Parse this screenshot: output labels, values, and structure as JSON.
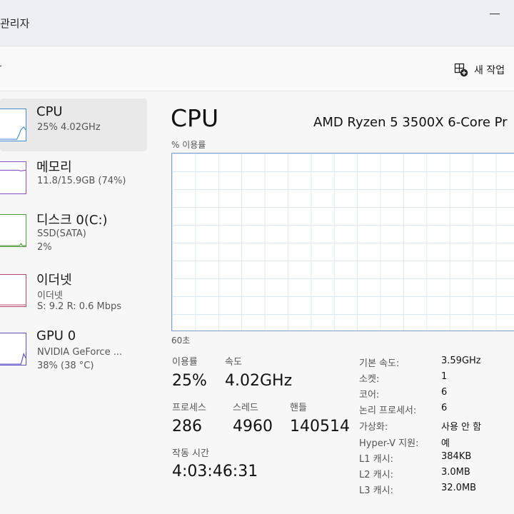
{
  "window": {
    "title": "관리자"
  },
  "toolbar": {
    "new_task_label": "새 작업",
    "new_task_icon": "new-task-icon"
  },
  "sidebar": {
    "items": [
      {
        "name": "CPU",
        "line1": "25% 4.02GHz",
        "line2": ""
      },
      {
        "name": "메모리",
        "line1": "11.8/15.9GB (74%)",
        "line2": ""
      },
      {
        "name": "디스크 0(C:)",
        "line1": "SSD(SATA)",
        "line2": "2%"
      },
      {
        "name": "이더넷",
        "line1": "이더넷",
        "line2": "S: 9.2 R: 0.6 Mbps"
      },
      {
        "name": "GPU 0",
        "line1": "NVIDIA GeForce ...",
        "line2": "38% (38 °C)"
      }
    ]
  },
  "main": {
    "title": "CPU",
    "model": "AMD Ryzen 5 3500X 6-Core Pr",
    "usage_label": "% 이용률",
    "time_label": "60초",
    "stats": {
      "utilization_label": "이용률",
      "utilization": "25%",
      "speed_label": "속도",
      "speed": "4.02GHz",
      "processes_label": "프로세스",
      "processes": "286",
      "threads_label": "스레드",
      "threads": "4960",
      "handles_label": "핸들",
      "handles": "140514",
      "uptime_label": "작동 시간",
      "uptime": "4:03:46:31"
    },
    "specs": [
      {
        "key": "기본 속도:",
        "value": "3.59GHz"
      },
      {
        "key": "소켓:",
        "value": "1"
      },
      {
        "key": "코어:",
        "value": "6"
      },
      {
        "key": "논리 프로세서:",
        "value": "6"
      },
      {
        "key": "가상화:",
        "value": "사용 안 함"
      },
      {
        "key": "Hyper-V 지원:",
        "value": "예"
      },
      {
        "key": "L1 캐시:",
        "value": "384KB"
      },
      {
        "key": "L2 캐시:",
        "value": "3.0MB"
      },
      {
        "key": "L3 캐시:",
        "value": "32.0MB"
      }
    ]
  },
  "colors": {
    "cpu": "#4a8bd0",
    "memory": "#8a4fc7",
    "disk": "#4f9a3a",
    "ethernet": "#b5476f",
    "gpu": "#5f4fc7",
    "graph_grid": "#dfe8f2"
  }
}
